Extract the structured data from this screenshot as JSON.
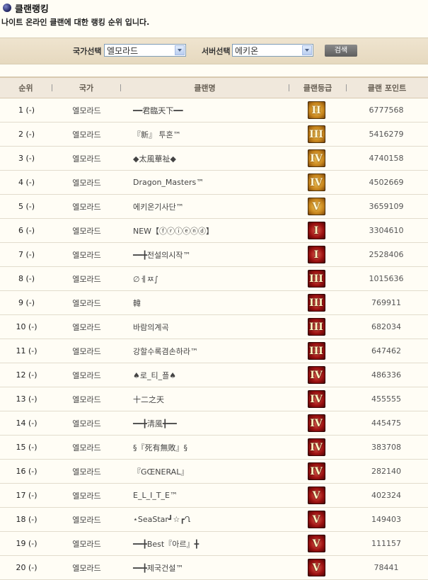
{
  "header": {
    "title": "클랜랭킹",
    "description": "나이트 온라인 클랜에 대한 랭킹 순위 입니다."
  },
  "search": {
    "country_label": "국가선택",
    "country_value": "엘모라드",
    "server_label": "서버선택",
    "server_value": "에키온",
    "button_label": "검색"
  },
  "table": {
    "columns": [
      "순위",
      "국가",
      "클랜명",
      "클랜등급",
      "클랜 포인트"
    ],
    "rows": [
      {
        "rank": "1 (-)",
        "country": "엘모라드",
        "name": "━━君臨天下━━",
        "grade": "II",
        "grade_color": "gold",
        "points": "6777568"
      },
      {
        "rank": "2 (-)",
        "country": "엘모라드",
        "name": "『新』 투혼™",
        "grade": "III",
        "grade_color": "gold",
        "points": "5416279"
      },
      {
        "rank": "3 (-)",
        "country": "엘모라드",
        "name": "◆太風華祉◆",
        "grade": "IV",
        "grade_color": "gold",
        "points": "4740158"
      },
      {
        "rank": "4 (-)",
        "country": "엘모라드",
        "name": "Dragon_Masters™",
        "grade": "IV",
        "grade_color": "gold",
        "points": "4502669"
      },
      {
        "rank": "5 (-)",
        "country": "엘모라드",
        "name": "에키온기사단™",
        "grade": "V",
        "grade_color": "gold",
        "points": "3659109"
      },
      {
        "rank": "6 (-)",
        "country": "엘모라드",
        "name": "NEW【ⓕⓡⓘⓔⓝⓓ】",
        "grade": "I",
        "grade_color": "red",
        "points": "3304610"
      },
      {
        "rank": "7 (-)",
        "country": "엘모라드",
        "name": "━━╋전설의시작™",
        "grade": "I",
        "grade_color": "red",
        "points": "2528406"
      },
      {
        "rank": "8 (-)",
        "country": "엘모라드",
        "name": "∅ㅔㅉ∫",
        "grade": "III",
        "grade_color": "red",
        "points": "1015636"
      },
      {
        "rank": "9 (-)",
        "country": "엘모라드",
        "name": "韓",
        "grade": "III",
        "grade_color": "red",
        "points": "769911"
      },
      {
        "rank": "10 (-)",
        "country": "엘모라드",
        "name": "바람의계곡",
        "grade": "III",
        "grade_color": "red",
        "points": "682034"
      },
      {
        "rank": "11 (-)",
        "country": "엘모라드",
        "name": "강할수록겸손하라™",
        "grade": "III",
        "grade_color": "red",
        "points": "647462"
      },
      {
        "rank": "12 (-)",
        "country": "엘모라드",
        "name": "♠로_티_플♠",
        "grade": "IV",
        "grade_color": "red",
        "points": "486336"
      },
      {
        "rank": "13 (-)",
        "country": "엘모라드",
        "name": "十二之天",
        "grade": "IV",
        "grade_color": "red",
        "points": "455555"
      },
      {
        "rank": "14 (-)",
        "country": "엘모라드",
        "name": "━━╋淸風╋━━",
        "grade": "IV",
        "grade_color": "red",
        "points": "445475"
      },
      {
        "rank": "15 (-)",
        "country": "엘모라드",
        "name": "§『死有無敗』§",
        "grade": "IV",
        "grade_color": "red",
        "points": "383708"
      },
      {
        "rank": "16 (-)",
        "country": "엘모라드",
        "name": "『GŒNERAL』",
        "grade": "IV",
        "grade_color": "red",
        "points": "282140"
      },
      {
        "rank": "17 (-)",
        "country": "엘모라드",
        "name": "E_L_I_T_E™",
        "grade": "V",
        "grade_color": "red",
        "points": "402324"
      },
      {
        "rank": "18 (-)",
        "country": "엘모라드",
        "name": "⋆SeaStar┛☆┏Ղ",
        "grade": "V",
        "grade_color": "red",
        "points": "149403"
      },
      {
        "rank": "19 (-)",
        "country": "엘모라드",
        "name": "━━╋Best『아르』╋",
        "grade": "V",
        "grade_color": "red",
        "points": "111157"
      },
      {
        "rank": "20 (-)",
        "country": "엘모라드",
        "name": "━━╋제국건설™",
        "grade": "V",
        "grade_color": "red",
        "points": "78441"
      }
    ]
  }
}
